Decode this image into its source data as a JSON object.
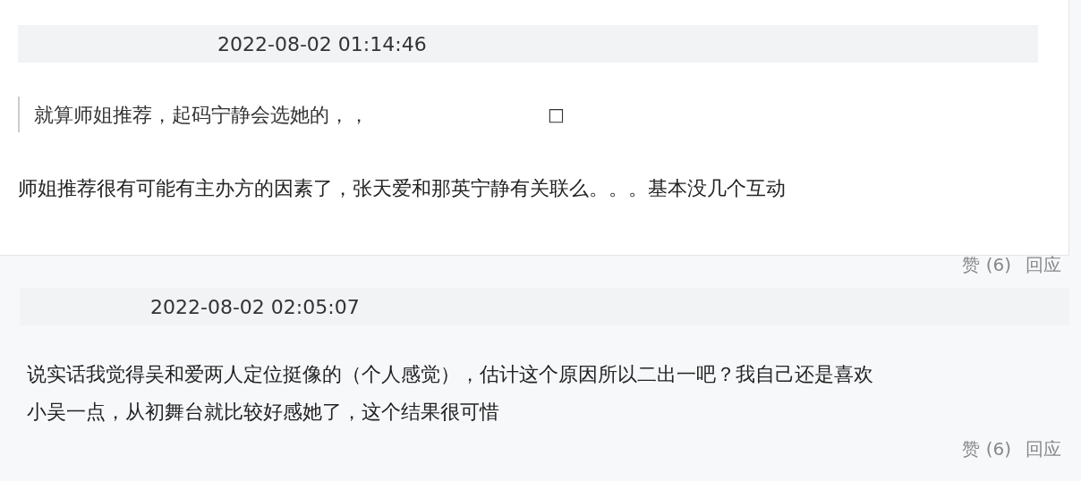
{
  "comments": [
    {
      "time": "2022-08-02 01:14:46",
      "quote": "就算师姐推荐，起码宁静会选她的，，",
      "quote_mark": "□",
      "body": [
        "师姐推荐很有可能有主办方的因素了，张天爱和那英宁静有关联么。。。基本没几个互动"
      ],
      "like": "赞 (6)",
      "reply": "回应"
    },
    {
      "time": "2022-08-02 02:05:07",
      "body": [
        "说实话我觉得吴和爱两人定位挺像的（个人感觉），估计这个原因所以二出一吧？我自己还是喜欢",
        "小吴一点，从初舞台就比较好感她了，这个结果很可惜"
      ],
      "like": "赞 (6)",
      "reply": "回应"
    }
  ]
}
